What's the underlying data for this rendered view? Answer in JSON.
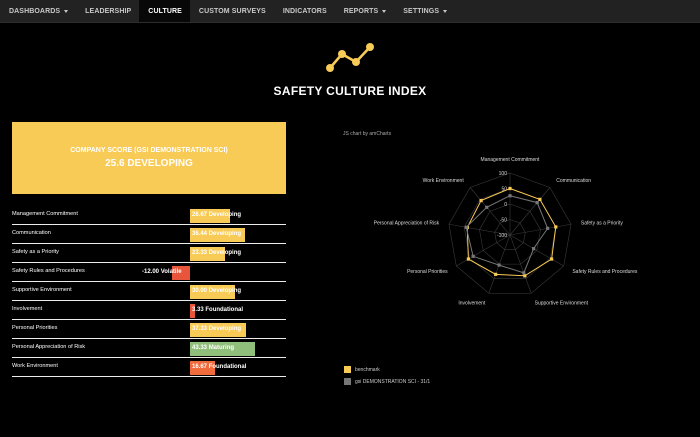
{
  "nav": {
    "items": [
      {
        "label": "DASHBOARDS",
        "dropdown": true,
        "active": false
      },
      {
        "label": "LEADERSHIP",
        "dropdown": false,
        "active": false
      },
      {
        "label": "CULTURE",
        "dropdown": false,
        "active": true
      },
      {
        "label": "CUSTOM SURVEYS",
        "dropdown": false,
        "active": false
      },
      {
        "label": "INDICATORS",
        "dropdown": false,
        "active": false
      },
      {
        "label": "REPORTS",
        "dropdown": true,
        "active": false
      },
      {
        "label": "SETTINGS",
        "dropdown": true,
        "active": false
      }
    ]
  },
  "page": {
    "title": "SAFETY CULTURE INDEX",
    "logo_icon": "chart-line-icon"
  },
  "company": {
    "label": "COMPANY SCORE (GSI DEMONSTRATION SCI)",
    "score": "25.6 DEVELOPING",
    "color": "#f8ca56"
  },
  "dimensions": [
    {
      "name": "Management Commitment",
      "value": 26.67,
      "value_text": "26.67",
      "level": "Developing",
      "color": "#f8ca56"
    },
    {
      "name": "Communication",
      "value": 36.44,
      "value_text": "36.44",
      "level": "Developing",
      "color": "#f8ca56"
    },
    {
      "name": "Safety as a Priority",
      "value": 23.33,
      "value_text": "23.33",
      "level": "Developing",
      "color": "#f8ca56"
    },
    {
      "name": "Safety Rules and Procedures",
      "value": -12.0,
      "value_text": "-12.00",
      "level": "Volatile",
      "color": "#e8553a"
    },
    {
      "name": "Supportive Environment",
      "value": 30.0,
      "value_text": "30.00",
      "level": "Developing",
      "color": "#f8ca56"
    },
    {
      "name": "Involvement",
      "value": 3.33,
      "value_text": "3.33",
      "level": "Foundational",
      "color": "#e8553a"
    },
    {
      "name": "Personal Priorities",
      "value": 37.33,
      "value_text": "37.33",
      "level": "Developing",
      "color": "#f8ca56"
    },
    {
      "name": "Personal Appreciation of Risk",
      "value": 43.33,
      "value_text": "43.33",
      "level": "Maturing",
      "color": "#8fbf7a"
    },
    {
      "name": "Work Environment",
      "value": 16.67,
      "value_text": "16.67",
      "level": "Foundational",
      "color": "#f06a3c"
    }
  ],
  "chart_credit": "JS chart by amCharts",
  "chart_data": {
    "type": "radar",
    "categories": [
      "Management Commitment",
      "Communication",
      "Safety as a Priority",
      "Safety Rules and Procedures",
      "Supportive Environment",
      "Involvement",
      "Personal Priorities",
      "Personal Appreciation of Risk",
      "Work Environment"
    ],
    "axis_ticks": [
      "100",
      "50",
      "0",
      "-50",
      "-100"
    ],
    "ylim": [
      -100,
      100
    ],
    "series": [
      {
        "name": "benchmark",
        "color": "#f8ca56",
        "values": [
          50,
          50,
          50,
          55,
          40,
          35,
          55,
          40,
          45
        ]
      },
      {
        "name": "gsi DEMONSTRATION SCI - 31/1",
        "color": "#777777",
        "values": [
          26.67,
          36.44,
          23.33,
          -12,
          30,
          3.33,
          37.33,
          43.33,
          16.67
        ]
      }
    ],
    "legend": "bottom-left"
  }
}
